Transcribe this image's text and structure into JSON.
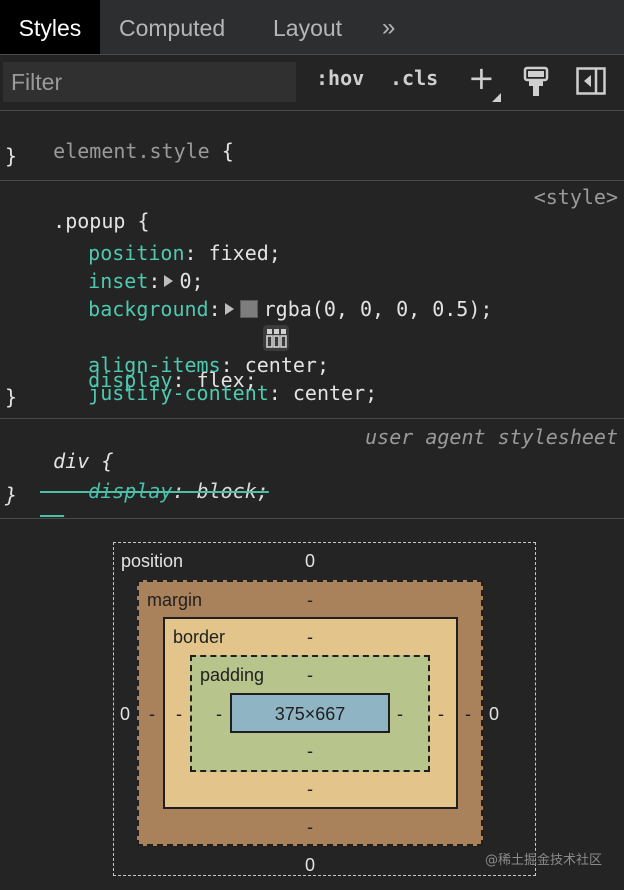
{
  "tabs": {
    "styles": "Styles",
    "computed": "Computed",
    "layout": "Layout",
    "more": "»"
  },
  "toolbar": {
    "filter_placeholder": "Filter",
    "hov": ":hov",
    "cls": ".cls",
    "plus": "+"
  },
  "element_style": {
    "selector": "element.style",
    "open": "{",
    "close": "}"
  },
  "popup_rule": {
    "selector": ".popup",
    "open": "{",
    "close": "}",
    "origin": "<style>",
    "declarations": [
      {
        "prop": "position",
        "value": "fixed;"
      },
      {
        "prop": "inset",
        "value": "0;"
      },
      {
        "prop": "background",
        "value": "rgba(0, 0, 0, 0.5);"
      },
      {
        "prop": "display",
        "value": "flex;"
      },
      {
        "prop": "align-items",
        "value": "center;"
      },
      {
        "prop": "justify-content",
        "value": "center;"
      }
    ]
  },
  "div_rule": {
    "selector": "div",
    "open": "{",
    "close": "}",
    "origin": "user agent stylesheet",
    "declarations": [
      {
        "prop": "display",
        "value": "block;"
      }
    ]
  },
  "box_model": {
    "position": {
      "label": "position",
      "top": "0",
      "left": "0",
      "right": "0",
      "bottom": "0"
    },
    "margin": {
      "label": "margin",
      "top": "-",
      "left": "-",
      "right": "-",
      "bottom": "-"
    },
    "border": {
      "label": "border",
      "top": "-",
      "left": "-",
      "right": "-",
      "bottom": "-"
    },
    "padding": {
      "label": "padding",
      "top": "-",
      "left": "-",
      "right": "-",
      "bottom": "-"
    },
    "content": "375×667"
  },
  "watermark": "@稀土掘金技术社区",
  "colors": {
    "background": "#242424",
    "property": "#4ec9b0",
    "margin": "#a9825c",
    "border": "#e3c58b",
    "padding": "#b7c48b",
    "content": "#8fb4c3"
  }
}
